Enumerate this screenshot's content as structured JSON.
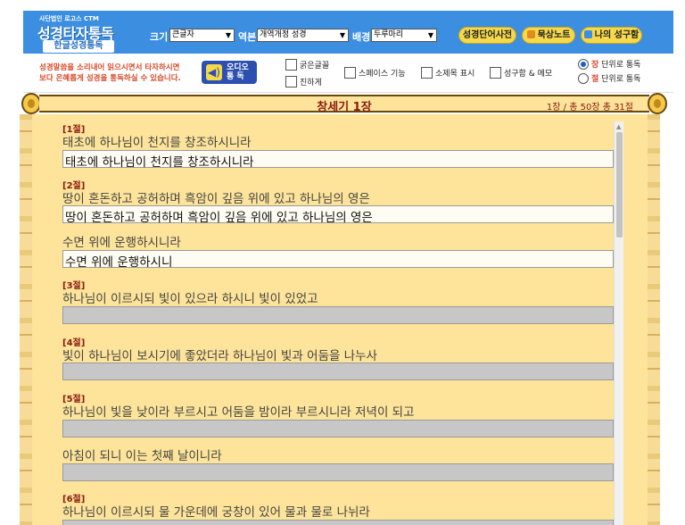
{
  "header": {
    "logo_small": "사단법인 로고스 CTM",
    "logo_main": "성경타자통독",
    "logo_sub": "한글성경통독",
    "size_label": "크기",
    "size_value": "큰글자",
    "version_label": "역본",
    "version_value": "개역개정 성경",
    "bg_label": "배경",
    "bg_value": "두루마리",
    "btn_dictionary": "성경단어사전",
    "btn_meditation": "묵상노트",
    "btn_myverse": "나의 성구함"
  },
  "options": {
    "message_line1": "성경말씀을 소리내어 읽으시면서 타자하시면",
    "message_line2": "보다 은혜롭게 성경을 통독하실 수 있습니다.",
    "audio_line1": "오디오",
    "audio_line2": "통 독",
    "chk_bold": "굵은글꼴",
    "chk_dark": "진하게",
    "chk_space": "스페이스 기능",
    "chk_subtitle": "소제목 표시",
    "chk_memo": "성구함 & 메모",
    "radio_chapter_key": "장",
    "radio_chapter_rest": " 단위로 통독",
    "radio_verse_key": "절",
    "radio_verse_rest": " 단위로 통독"
  },
  "scroll": {
    "title": "창세기 1장",
    "info": "1장 / 총 50장   총 31절"
  },
  "verses": [
    {
      "label": "[1절]",
      "text": "태초에 하나님이 천지를 창조하시니라",
      "typed": "태초에 하나님이 천지를 창조하시니라"
    },
    {
      "label": "[2절]",
      "text": "땅이 혼돈하고 공허하며 흑암이 깊음 위에 있고 하나님의 영은",
      "typed": "땅이 혼돈하고 공허하며 흑암이 깊음 위에 있고 하나님의 영은"
    },
    {
      "label": "",
      "text": "수면 위에 운행하시니라",
      "typed": "수면 위에 운행하시니"
    },
    {
      "label": "[3절]",
      "text": "하나님이 이르시되 빛이 있으라 하시니 빛이 있었고",
      "typed": ""
    },
    {
      "label": "[4절]",
      "text": "빛이 하나님이 보시기에 좋았더라 하나님이 빛과 어둠을 나누사",
      "typed": ""
    },
    {
      "label": "[5절]",
      "text": "하나님이 빛을 낮이라 부르시고 어둠을 밤이라 부르시니라 저녁이 되고",
      "typed": ""
    },
    {
      "label": "",
      "text": "아침이 되니 이는 첫째 날이니라",
      "typed": ""
    },
    {
      "label": "[6절]",
      "text": "하나님이 이르시되 물 가운데에 궁창이 있어 물과 물로 나뉘라",
      "typed": ""
    }
  ]
}
